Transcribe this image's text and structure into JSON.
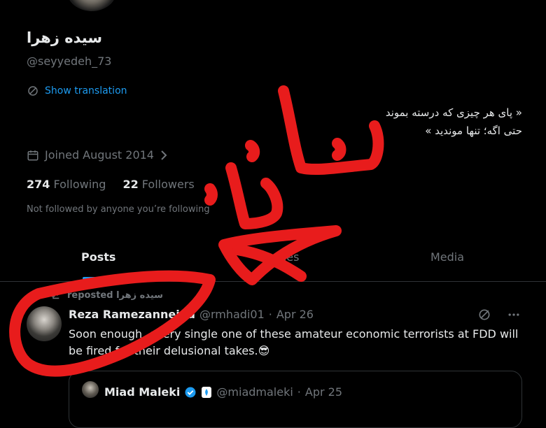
{
  "profile": {
    "name": "سیده زهرا",
    "handle": "@seyyedeh_73",
    "show_translation": "Show translation",
    "bio_line1": "« پای هر چیزی که درسته بموند",
    "bio_line2": "حتی اگه؛ تنها موندید »",
    "joined": "Joined August 2014",
    "following_count": "274",
    "following_label": "Following",
    "followers_count": "22",
    "followers_label": "Followers",
    "not_followed": "Not followed by anyone you’re following"
  },
  "tabs": [
    "Posts",
    "Replies",
    "Media"
  ],
  "tweet": {
    "repost_label": "سیده زهرا reposted",
    "author_name": "Reza Ramezannejad",
    "author_handle": "@rmhadi01",
    "date": "Apr 26",
    "text": "Soon enough, every single one of these amateur economic terrorists at FDD will be fired for their delusional takes.😎",
    "quote": {
      "author_name": "Miad Maleki",
      "author_handle": "@miadmaleki",
      "date": "Apr 25"
    }
  },
  "colors": {
    "accent": "#1d9bf0",
    "scribble": "#e81c1c",
    "background": "#000000"
  }
}
